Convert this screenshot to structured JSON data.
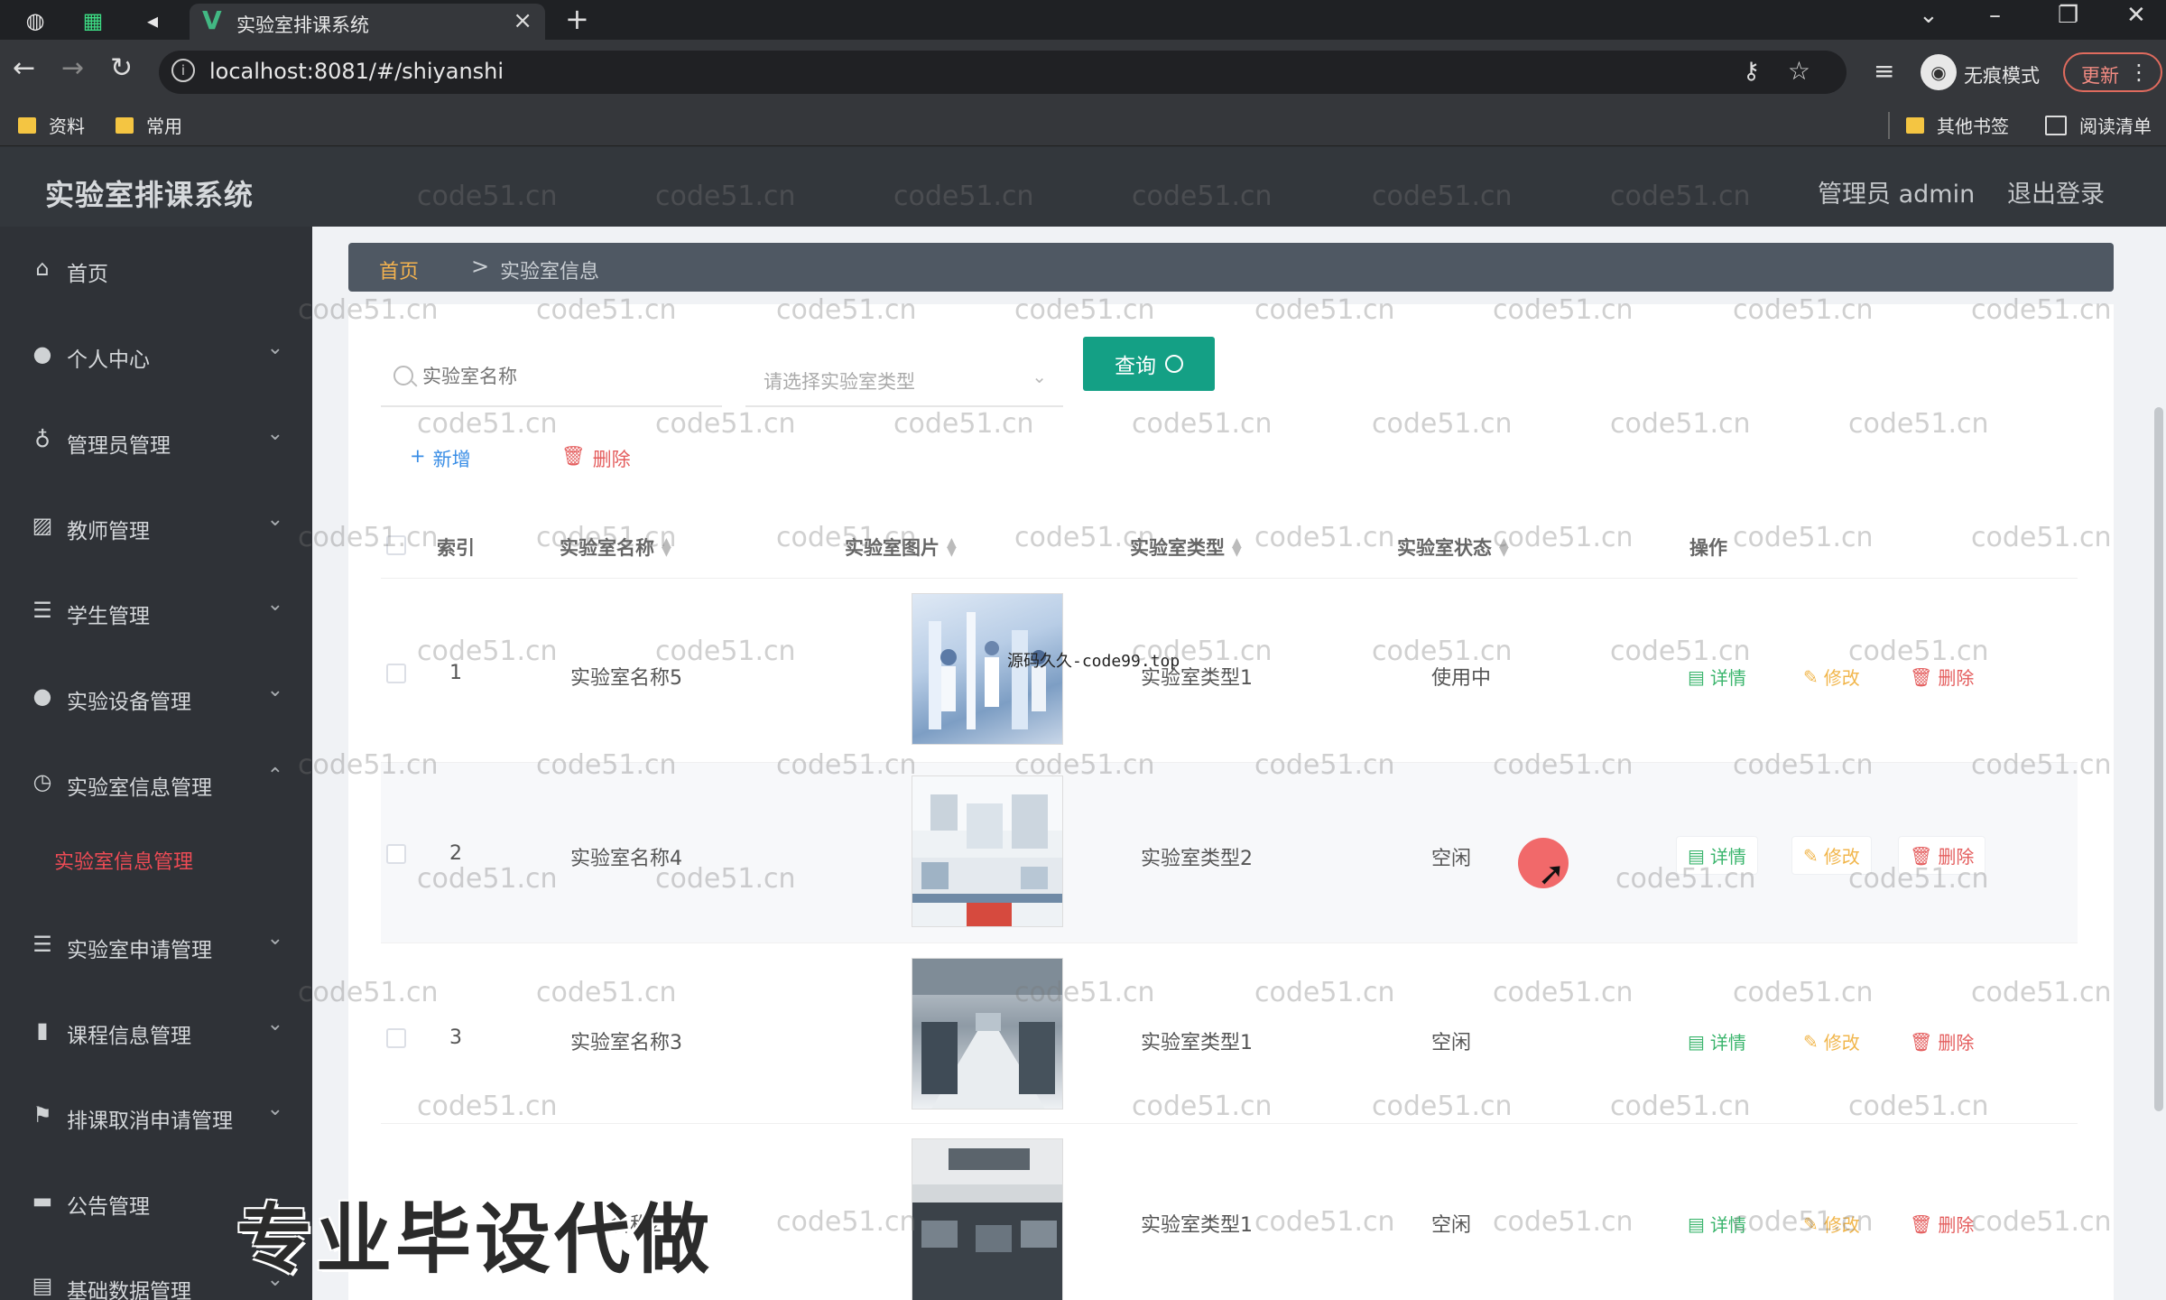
{
  "browser": {
    "tab_title": "实验室排课系统",
    "url": "localhost:8081/#/shiyanshi",
    "incognito_label": "无痕模式",
    "update_label": "更新",
    "bookmarks": [
      "资料",
      "常用"
    ],
    "other_bookmarks": "其他书签",
    "reading_list": "阅读清单"
  },
  "header": {
    "app_title": "实验室排课系统",
    "user": "管理员 admin",
    "logout": "退出登录"
  },
  "sidebar": {
    "items": [
      {
        "label": "首页",
        "icon": "home-icon"
      },
      {
        "label": "个人中心",
        "icon": "user-icon"
      },
      {
        "label": "管理员管理",
        "icon": "mic-icon"
      },
      {
        "label": "教师管理",
        "icon": "chart-icon"
      },
      {
        "label": "学生管理",
        "icon": "list-icon"
      },
      {
        "label": "实验设备管理",
        "icon": "user-icon"
      },
      {
        "label": "实验室信息管理",
        "icon": "clock-icon"
      },
      {
        "label": "实验室申请管理",
        "icon": "list-icon"
      },
      {
        "label": "课程信息管理",
        "icon": "bar-chart-icon"
      },
      {
        "label": "排课取消申请管理",
        "icon": "flag-icon"
      },
      {
        "label": "公告管理",
        "icon": "monitor-icon"
      },
      {
        "label": "基础数据管理",
        "icon": "doc-icon"
      }
    ],
    "active_sub": "实验室信息管理"
  },
  "breadcrumb": {
    "home": "首页",
    "separator": ">",
    "current": "实验室信息"
  },
  "search": {
    "name_placeholder": "实验室名称",
    "type_placeholder": "请选择实验室类型",
    "query_label": "查询"
  },
  "actions": {
    "add": "新增",
    "delete": "删除"
  },
  "table": {
    "headers": [
      "索引",
      "实验室名称",
      "实验室图片",
      "实验室类型",
      "实验室状态",
      "操作"
    ],
    "rows": [
      {
        "index": "1",
        "name": "实验室名称5",
        "type": "实验室类型1",
        "status": "使用中"
      },
      {
        "index": "2",
        "name": "实验室名称4",
        "type": "实验室类型2",
        "status": "空闲"
      },
      {
        "index": "3",
        "name": "实验室名称3",
        "type": "实验室类型1",
        "status": "空闲"
      },
      {
        "index": "",
        "name": "名称2",
        "type": "实验室类型1",
        "status": "空闲"
      }
    ],
    "ops": {
      "detail": "详情",
      "edit": "修改",
      "remove": "删除"
    }
  },
  "overlays": {
    "source_text": "源码久久-code99.top",
    "promo": "专业毕设代做",
    "watermark": "code51.cn"
  },
  "colors": {
    "sidebar_bg": "#2f3237",
    "accent": "#14a085",
    "active_menu": "#ee4b55",
    "breadcrumb_home": "#f3b24f"
  }
}
